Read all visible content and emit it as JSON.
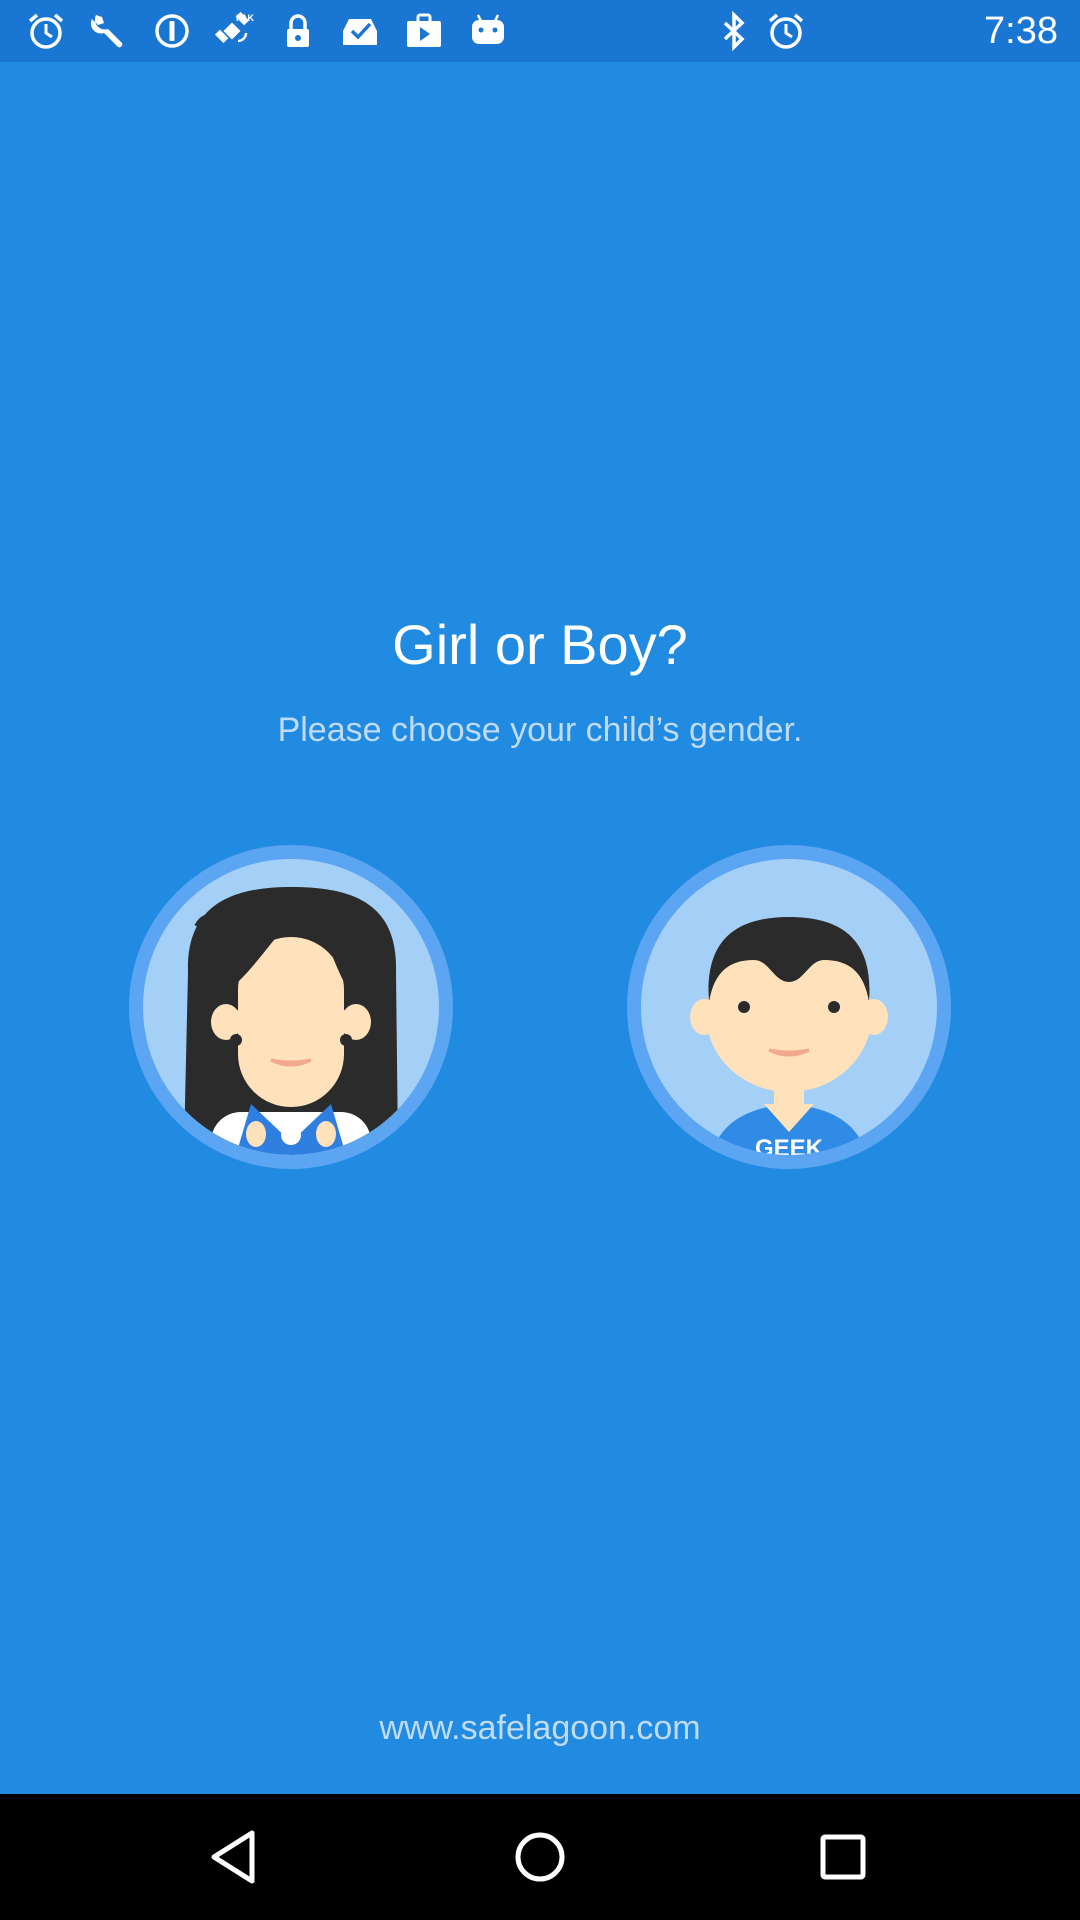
{
  "status_bar": {
    "time": "7:38",
    "left_icons": [
      "alarm-clock-icon",
      "wrench-icon",
      "info-icon",
      "fake-gps-satellite-icon",
      "lock-icon",
      "inbox-check-icon",
      "play-store-icon",
      "android-icon"
    ],
    "right_icons": [
      "bluetooth-icon",
      "alarm-clock-icon"
    ]
  },
  "main": {
    "title": "Girl or Boy?",
    "subtitle": "Please choose your child’s gender.",
    "options": [
      {
        "name": "girl",
        "icon": "girl-avatar-icon"
      },
      {
        "name": "boy",
        "icon": "boy-avatar-icon",
        "shirt_text": "GEEK"
      }
    ]
  },
  "footer": {
    "website": "www.safelagoon.com"
  },
  "nav_bar": {
    "buttons": [
      "back-triangle-icon",
      "home-circle-icon",
      "recents-square-icon"
    ]
  },
  "colors": {
    "background": "#218AE1",
    "status_bar": "#1976D2",
    "avatar_ring": "#5BA5F2",
    "avatar_fill": "#A4D0F7",
    "skin": "#FFE1BC",
    "hair": "#2B2B2B"
  }
}
